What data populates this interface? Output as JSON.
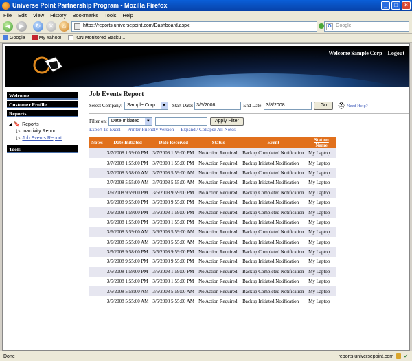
{
  "window": {
    "title": "Universe Point Partnership Program - Mozilla Firefox"
  },
  "menu": [
    "File",
    "Edit",
    "View",
    "History",
    "Bookmarks",
    "Tools",
    "Help"
  ],
  "nav": {
    "url": "https://reports.universepoint.com/Dashboard.aspx",
    "search_placeholder": "Google"
  },
  "bookmarks": [
    "Google",
    "My Yahoo!",
    "ION Monitored Backu..."
  ],
  "banner": {
    "welcome": "Welcome Sample Corp",
    "logout": "Logout"
  },
  "sidebar": {
    "welcome": "Welcome",
    "profile": "Customer Profile",
    "reports": "Reports",
    "tree_root": "Reports",
    "tree_items": [
      "Inactivity Report",
      "Job Events Report"
    ],
    "tools": "Tools"
  },
  "page": {
    "title": "Job Events Report",
    "company_label": "Select Company:",
    "company_value": "Sample Corp",
    "start_label": "Start Date:",
    "start_value": "3/5/2008",
    "end_label": "End Date:",
    "end_value": "3/8/2008",
    "go": "Go",
    "help": "Need Help?",
    "filter_label": "Filter on:",
    "filter_value": "Date Initiated",
    "filter_text": "",
    "apply": "Apply Filter",
    "links": [
      "Export To Excel",
      "Printer Friendly Version",
      "Expand / Collapse All Notes"
    ]
  },
  "table": {
    "headers": [
      "Notes",
      "Date Initiated",
      "Date Received",
      "Status",
      "Event",
      "Station Name"
    ],
    "rows": [
      [
        "",
        "3/7/2008 1:59:00 PM",
        "3/7/2008 1:59:00 PM",
        "No Action Required",
        "Backup Completed Notification",
        "My Laptop"
      ],
      [
        "",
        "3/7/2008 1:55:00 PM",
        "3/7/2008 1:55:00 PM",
        "No Action Required",
        "Backup Initiated Notification",
        "My Laptop"
      ],
      [
        "",
        "3/7/2008 5:58:00 AM",
        "3/7/2008 5:59:00 AM",
        "No Action Required",
        "Backup Completed Notification",
        "My Laptop"
      ],
      [
        "",
        "3/7/2008 5:55:00 AM",
        "3/7/2008 5:55:00 AM",
        "No Action Required",
        "Backup Initiated Notification",
        "My Laptop"
      ],
      [
        "",
        "3/6/2008 9:59:00 PM",
        "3/6/2008 9:59:00 PM",
        "No Action Required",
        "Backup Completed Notification",
        "My Laptop"
      ],
      [
        "",
        "3/6/2008 9:55:00 PM",
        "3/6/2008 9:55:00 PM",
        "No Action Required",
        "Backup Initiated Notification",
        "My Laptop"
      ],
      [
        "",
        "3/6/2008 1:59:00 PM",
        "3/6/2008 1:59:00 PM",
        "No Action Required",
        "Backup Completed Notification",
        "My Laptop"
      ],
      [
        "",
        "3/6/2008 1:55:00 PM",
        "3/6/2008 1:55:00 PM",
        "No Action Required",
        "Backup Initiated Notification",
        "My Laptop"
      ],
      [
        "",
        "3/6/2008 5:59:00 AM",
        "3/6/2008 5:59:00 AM",
        "No Action Required",
        "Backup Completed Notification",
        "My Laptop"
      ],
      [
        "",
        "3/6/2008 5:55:00 AM",
        "3/6/2008 5:55:00 AM",
        "No Action Required",
        "Backup Initiated Notification",
        "My Laptop"
      ],
      [
        "",
        "3/5/2008 9:58:00 PM",
        "3/5/2008 9:59:00 PM",
        "No Action Required",
        "Backup Completed Notification",
        "My Laptop"
      ],
      [
        "",
        "3/5/2008 9:55:00 PM",
        "3/5/2008 9:55:00 PM",
        "No Action Required",
        "Backup Initiated Notification",
        "My Laptop"
      ],
      [
        "",
        "3/5/2008 1:59:00 PM",
        "3/5/2008 1:59:00 PM",
        "No Action Required",
        "Backup Completed Notification",
        "My Laptop"
      ],
      [
        "",
        "3/5/2008 1:55:00 PM",
        "3/5/2008 1:55:00 PM",
        "No Action Required",
        "Backup Initiated Notification",
        "My Laptop"
      ],
      [
        "",
        "3/5/2008 5:58:00 AM",
        "3/5/2008 5:59:00 AM",
        "No Action Required",
        "Backup Completed Notification",
        "My Laptop"
      ],
      [
        "",
        "3/5/2008 5:55:00 AM",
        "3/5/2008 5:55:00 AM",
        "No Action Required",
        "Backup Initiated Notification",
        "My Laptop"
      ]
    ]
  },
  "status": {
    "left": "Done",
    "right": "reports.universepoint.com"
  }
}
